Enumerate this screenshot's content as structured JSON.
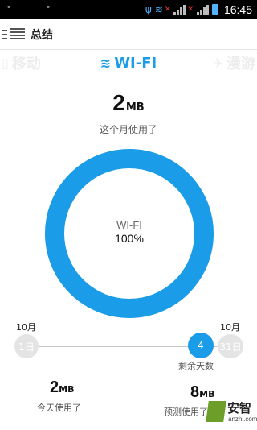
{
  "status_bar": {
    "time": "16:45",
    "icons": [
      "usb-icon",
      "wifi-icon",
      "signal-icon",
      "battery-icon"
    ]
  },
  "action_bar": {
    "title": "总结",
    "menu_icon": "menu-drawer-icon"
  },
  "tabs": [
    {
      "label": "移动",
      "icon": "mobile-icon",
      "active": false
    },
    {
      "label": "WI-FI",
      "icon": "wifi-icon",
      "active": true
    },
    {
      "label": "漫游",
      "icon": "airplane-icon",
      "active": false
    }
  ],
  "monthly_usage": {
    "value": "2",
    "unit": "MB",
    "caption": "这个月使用了"
  },
  "ring": {
    "label": "WI-FI",
    "percent_text": "100%",
    "percent": 100,
    "color": "#1a9ce8"
  },
  "timeline": {
    "start_month": "10月",
    "start_day": "1日",
    "end_month": "10月",
    "end_day": "31日",
    "remaining_days": "4",
    "remaining_label": "剩余天数"
  },
  "today_usage": {
    "value": "2",
    "unit": "MB",
    "caption": "今天使用了"
  },
  "predicted_usage": {
    "value": "8",
    "unit": "MB",
    "caption": "预测使用了"
  },
  "watermark": {
    "name": "安智",
    "url": "anzhi.com"
  },
  "colors": {
    "accent": "#1a9ce8",
    "inactive_tab": "#ededed"
  }
}
